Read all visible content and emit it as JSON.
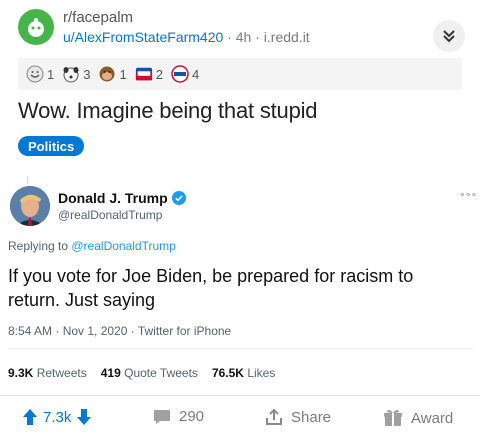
{
  "header": {
    "subreddit": "r/facepalm",
    "author": "u/AlexFromStateFarm420",
    "separator": "·",
    "age": "4h",
    "domain": "i.redd.it"
  },
  "awards": [
    {
      "icon": "wholesome-seal-icon",
      "count": "1"
    },
    {
      "icon": "dog-face-icon",
      "count": "3"
    },
    {
      "icon": "monkey-face-icon",
      "count": "1"
    },
    {
      "icon": "voted-badge-icon",
      "count": "2"
    },
    {
      "icon": "vote-pin-icon",
      "count": "4"
    }
  ],
  "post": {
    "title": "Wow. Imagine being that stupid",
    "flair": "Politics"
  },
  "tweet": {
    "name": "Donald J. Trump",
    "handle": "@realDonaldTrump",
    "more": "°°°",
    "replying_prefix": "Replying to ",
    "replying_to": "@realDonaldTrump",
    "text": "If you vote for Joe Biden, be prepared for racism to return. Just saying",
    "timestamp": "8:54 AM · Nov 1, 2020 · Twitter for iPhone",
    "stats": [
      {
        "value": "9.3K",
        "label": "Retweets"
      },
      {
        "value": "419",
        "label": "Quote Tweets"
      },
      {
        "value": "76.5K",
        "label": "Likes"
      }
    ]
  },
  "actions": {
    "votes": "7.3k",
    "comments": "290",
    "share": "Share",
    "award": "Award"
  },
  "colors": {
    "reddit_blue": "#0079d3",
    "twitter_blue": "#1d9bf0",
    "subreddit_avatar": "#46b44a"
  }
}
